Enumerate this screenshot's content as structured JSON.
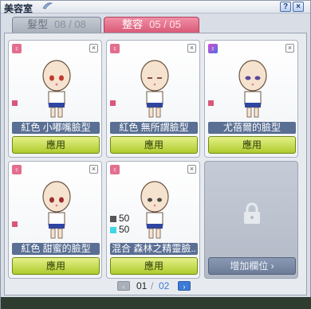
{
  "window": {
    "title": "美容室"
  },
  "tabs": [
    {
      "label": "髮型",
      "count": "08 / 08"
    },
    {
      "label": "整容",
      "count": "05 / 05"
    }
  ],
  "cards": [
    {
      "gender": "♀",
      "name": "紅色 小嘟嘴臉型",
      "apply": "應用"
    },
    {
      "gender": "♀",
      "name": "紅色 無所謂臉型",
      "apply": "應用"
    },
    {
      "gender": "♀",
      "name": "尤蓓爾的臉型",
      "apply": "應用"
    },
    {
      "gender": "♀",
      "name": "紅色 甜蜜的臉型",
      "apply": "應用"
    },
    {
      "gender": "♀",
      "name": "混合 森林之精靈臉..",
      "apply": "應用",
      "mix": [
        "50",
        "50"
      ]
    }
  ],
  "locked_slot": {
    "label": "增加欄位 ›"
  },
  "pager": {
    "current": "01",
    "separator": "/",
    "total": "02"
  },
  "colors": {
    "accent_tab": "#d95a78",
    "apply_button": "#aecb2c",
    "name_bar": "#5a6f93"
  }
}
